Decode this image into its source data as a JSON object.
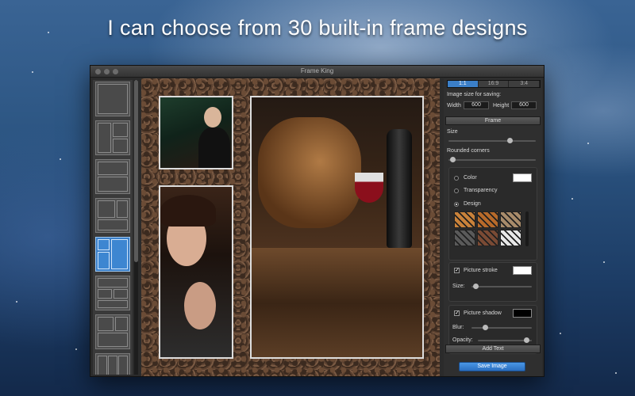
{
  "headline": "I can choose from 30 built-in frame designs",
  "window": {
    "title": "Frame King"
  },
  "aspect_tabs": [
    {
      "label": "1:1",
      "active": true
    },
    {
      "label": "16:9",
      "active": false
    },
    {
      "label": "3:4",
      "active": false
    }
  ],
  "panel": {
    "image_size_label": "Image size for saving:",
    "width_label": "Width",
    "width_value": "600",
    "height_label": "Height",
    "height_value": "600",
    "frame_button": "Frame",
    "size_label": "Size",
    "size_value": 0.72,
    "rounded_corners_label": "Rounded corners",
    "rounded_corners_value": 0.02,
    "color_label": "Color",
    "transparency_label": "Transparency",
    "design_label": "Design",
    "fill_mode": "design",
    "color_swatch": "#ffffff",
    "picture_stroke_label": "Picture stroke",
    "picture_stroke_checked": true,
    "stroke_swatch": "#ffffff",
    "stroke_size_label": "Size:",
    "stroke_size_value": 0.03,
    "picture_shadow_label": "Picture shadow",
    "picture_shadow_checked": true,
    "shadow_swatch": "#000000",
    "blur_label": "Blur:",
    "blur_value": 0.2,
    "opacity_label": "Opacity:",
    "opacity_value": 0.95,
    "add_text_button": "Add Text",
    "save_button": "Save Image"
  },
  "textures": [
    "#c9823a",
    "#b76a2a",
    "#a88b6a",
    "#5a5a5a",
    "#7a4a34",
    "#e8e8e8"
  ],
  "selected_layout_index": 4,
  "colors": {
    "accent": "#3b7fc8",
    "window": "#2b2b2b"
  }
}
